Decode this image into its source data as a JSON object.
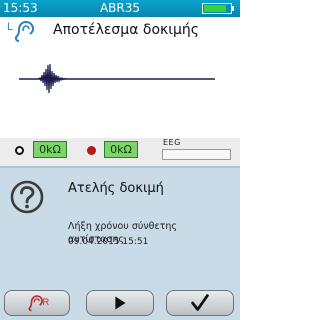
{
  "status_bar": {
    "time": "15:53",
    "device_name": "ABR35",
    "battery_level": 0.85
  },
  "header": {
    "ear_side": "L",
    "title": "Αποτέλεσμα δοκιμής"
  },
  "impedance": {
    "electrode_1_value": "0kΩ",
    "electrode_2_value": "0kΩ",
    "eeg_label": "EEG"
  },
  "result": {
    "title": "Ατελής δοκιμή",
    "message": "Λήξη χρόνου σύνθετης αντίστασης",
    "timestamp": "09.04.2015  15:51"
  },
  "buttons": {
    "retest_ear_letter": "R",
    "retest_icon": "ear-icon",
    "play_icon": "play-icon",
    "confirm_icon": "checkmark-icon"
  },
  "colors": {
    "status_bar": "#0a9cc4",
    "impedance_ok": "#7fd36b",
    "result_panel": "#c9dbe6",
    "right_ear": "#c0282d",
    "left_ear": "#2d7fc0"
  }
}
